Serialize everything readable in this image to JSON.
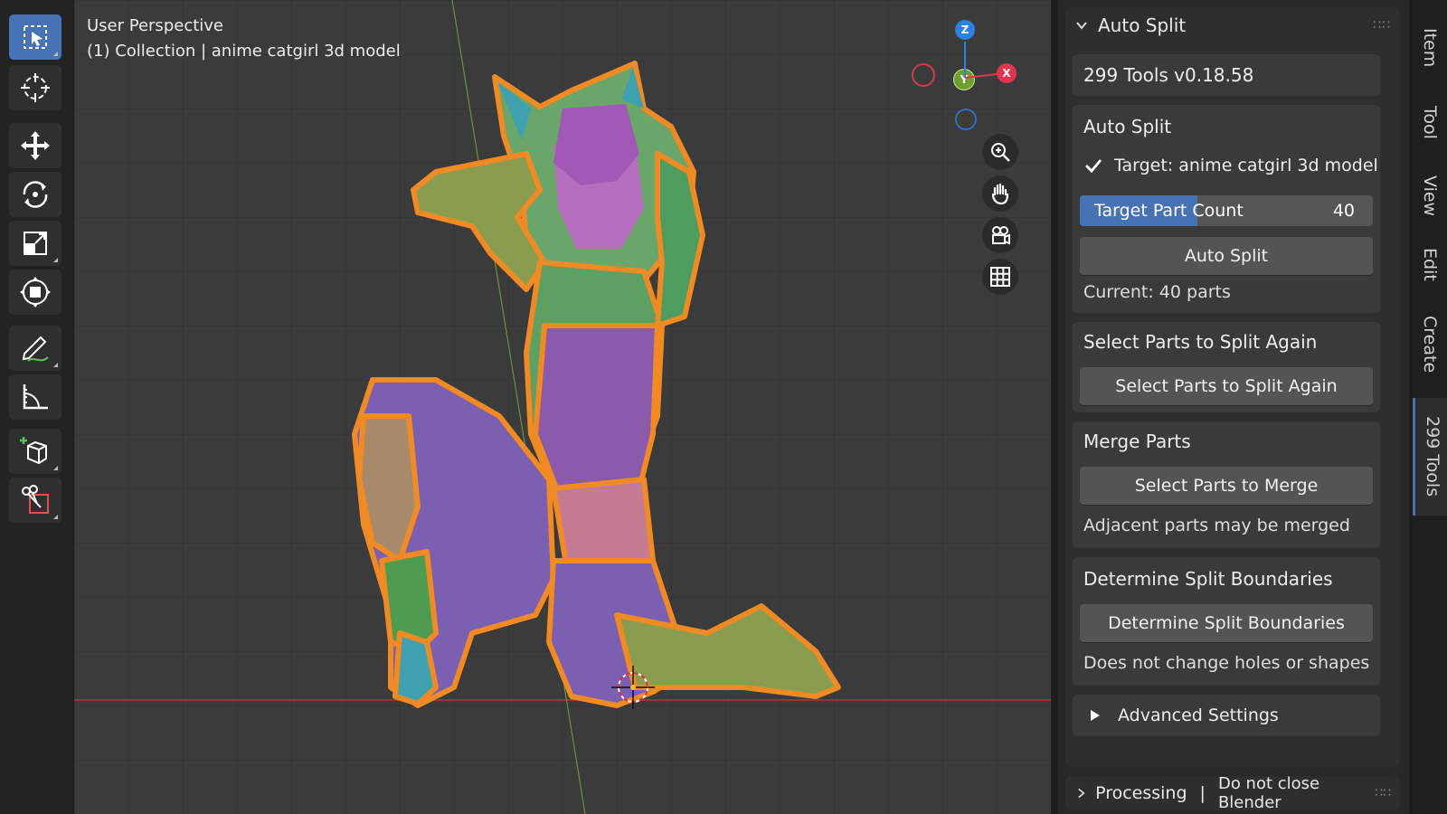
{
  "viewport": {
    "view_name": "User Perspective",
    "collection_line": "(1) Collection | anime catgirl 3d model",
    "gizmo": {
      "z": "Z",
      "y": "Y",
      "x": "X"
    }
  },
  "toolbar": {
    "tools": [
      "select-box-icon",
      "cursor-icon",
      "move-icon",
      "rotate-icon",
      "scale-icon",
      "transform-icon",
      "annotate-icon",
      "measure-icon",
      "add-cube-icon",
      "cut-icon"
    ]
  },
  "nav_buttons": [
    "zoom-icon",
    "pan-hand-icon",
    "camera-icon",
    "grid-icon"
  ],
  "panel": {
    "header": "Auto Split",
    "version": "299 Tools  v0.18.58",
    "auto_split": {
      "title": "Auto Split",
      "target_label": "Target: anime catgirl 3d model",
      "target_checked": true,
      "part_count_label": "Target Part Count",
      "part_count_value": "40",
      "part_count_fill": 0.4,
      "button": "Auto Split",
      "current": "Current: 40 parts"
    },
    "split_again": {
      "title": "Select Parts to Split Again",
      "button": "Select Parts to Split Again"
    },
    "merge": {
      "title": "Merge Parts",
      "button": "Select Parts to Merge",
      "note": "Adjacent parts may be merged"
    },
    "boundaries": {
      "title": "Determine Split Boundaries",
      "button": "Determine Split Boundaries",
      "note": "Does not change holes or shapes"
    },
    "advanced": "Advanced Settings"
  },
  "footer": {
    "label": "Processing",
    "separator": "|",
    "message": "Do not close Blender"
  },
  "tabs": [
    "Item",
    "Tool",
    "View",
    "Edit",
    "Create",
    "299 Tools"
  ],
  "colors": {
    "accent": "#4772b3",
    "selection_outline": "#f08a24",
    "axis_x": "#e0344f",
    "axis_y": "#8fc43a",
    "axis_z": "#2d80e0"
  }
}
